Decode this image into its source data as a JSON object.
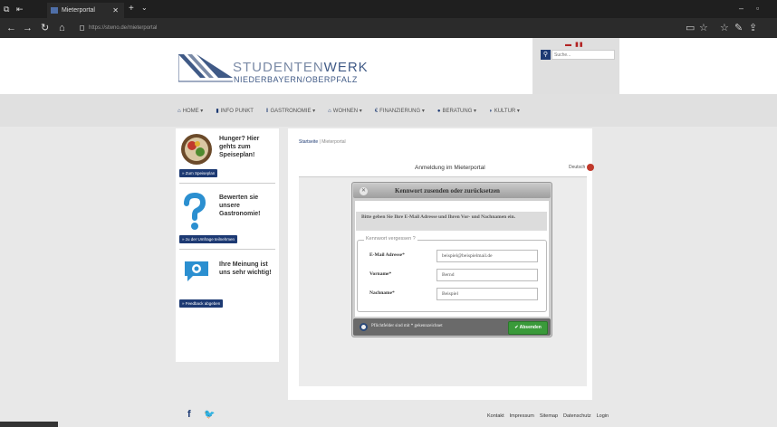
{
  "browser": {
    "tab_title": "Mieterportal",
    "url": "https://stwno.de/mieterportal"
  },
  "header": {
    "brand_light": "STUDENTEN",
    "brand_bold": "WERK",
    "brand_sub": "NIEDERBAYERN/OBERPFALZ",
    "search_placeholder": "Suche..."
  },
  "menu": [
    {
      "label": "HOME",
      "icon": "home-icon"
    },
    {
      "label": "INFO PUNKT",
      "icon": "info-icon"
    },
    {
      "label": "GASTRONOMIE",
      "icon": "fork-icon"
    },
    {
      "label": "WOHNEN",
      "icon": "house-icon"
    },
    {
      "label": "FINANZIERUNG",
      "icon": "euro-icon"
    },
    {
      "label": "BERATUNG",
      "icon": "pin-icon"
    },
    {
      "label": "KULTUR",
      "icon": "mask-icon"
    }
  ],
  "sidebar": {
    "promo1": {
      "title": "Hunger? Hier gehts zum Speiseplan!",
      "button": "» Zum Speiseplan"
    },
    "promo2": {
      "title": "Bewerten sie unsere Gastronomie!",
      "button": "» zu der Umfrage teilnehmen"
    },
    "promo3": {
      "title": "Ihre Meinung ist uns sehr wichtig!",
      "button": "» Feedback abgeben"
    }
  },
  "main": {
    "breadcrumb_home": "Startseite",
    "breadcrumb_current": "Mieterportal",
    "portal_title": "Anmeldung im Mieterportal",
    "language": "Deutsch"
  },
  "modal": {
    "title": "Kennwort zusenden oder zurücksetzen",
    "info": "Bitte geben Sie Ihre E-Mail Adresse und Ihren Vor- und Nachnamen ein.",
    "legend": "Kennwort vergessen ?",
    "fields": [
      {
        "label": "E-Mail Adresse*",
        "value": "beispiel@beispielmail.de"
      },
      {
        "label": "Vorname*",
        "value": "Bernd"
      },
      {
        "label": "Nachname*",
        "value": "Beispiel"
      }
    ],
    "footer_note": "Pflichtfelder sind mit * gekennzeichnet",
    "submit": "Absenden"
  },
  "footer": {
    "links": [
      "Kontakt",
      "Impressum",
      "Sitemap",
      "Datenschutz",
      "Login"
    ]
  }
}
